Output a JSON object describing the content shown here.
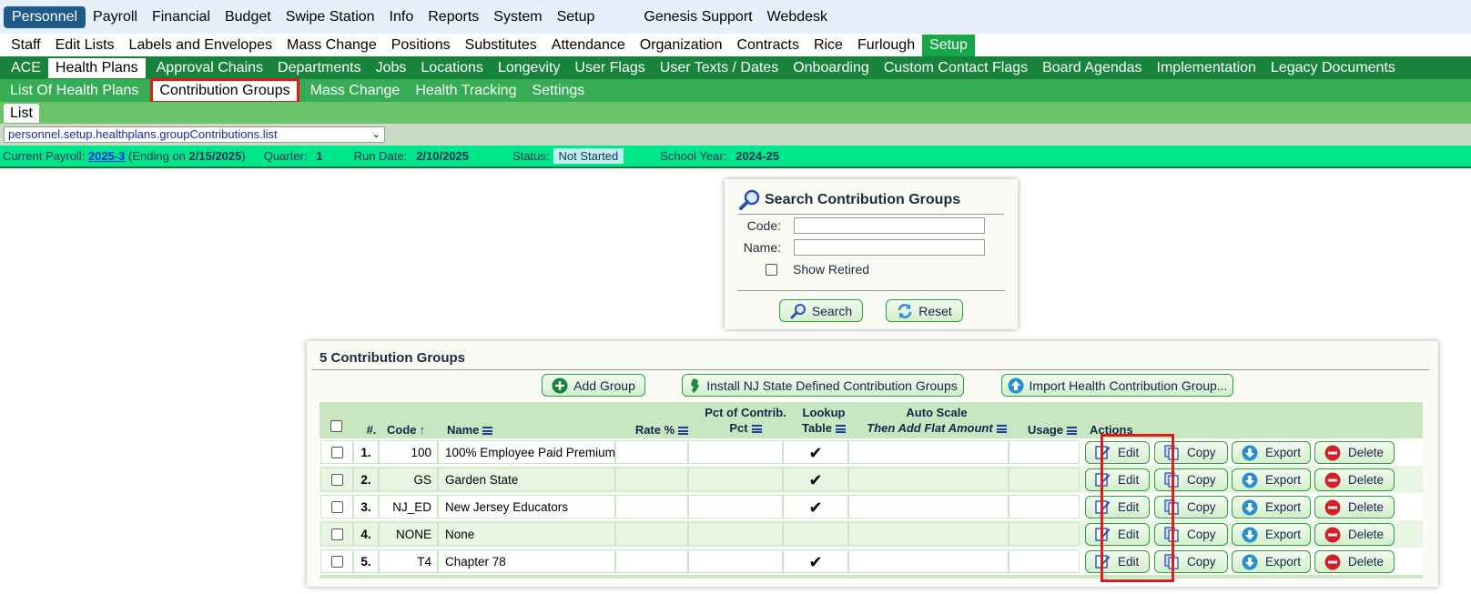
{
  "nav_top": [
    "Personnel",
    "Payroll",
    "Financial",
    "Budget",
    "Swipe Station",
    "Info",
    "Reports",
    "System",
    "Setup"
  ],
  "nav_top_right": [
    "Genesis Support",
    "Webdesk"
  ],
  "nav_second": [
    "Staff",
    "Edit Lists",
    "Labels and Envelopes",
    "Mass Change",
    "Positions",
    "Substitutes",
    "Attendance",
    "Organization",
    "Contracts",
    "Rice",
    "Furlough",
    "Setup"
  ],
  "nav_third": [
    "ACE",
    "Health Plans",
    "Approval Chains",
    "Departments",
    "Jobs",
    "Locations",
    "Longevity",
    "User Flags",
    "User Texts / Dates",
    "Onboarding",
    "Custom Contact Flags",
    "Board Agendas",
    "Implementation",
    "Legacy Documents"
  ],
  "nav_fourth": [
    "List Of Health Plans",
    "Contribution Groups",
    "Mass Change",
    "Health Tracking",
    "Settings"
  ],
  "nav_fifth": [
    "List"
  ],
  "path_select": "personnel.setup.healthplans.groupContributions.list",
  "status": {
    "payroll_label": "Current Payroll:",
    "payroll_link": "2025-3",
    "payroll_ending_open": " (Ending on ",
    "payroll_ending_date": "2/15/2025",
    "payroll_ending_close": ")",
    "quarter_label": "Quarter:",
    "quarter_value": "1",
    "run_date_label": "Run Date:",
    "run_date_value": "2/10/2025",
    "status_label": "Status:",
    "status_value": "Not Started",
    "school_year_label": "School Year:",
    "school_year_value": "2024-25"
  },
  "search": {
    "title": "Search Contribution Groups",
    "code_label": "Code:",
    "name_label": "Name:",
    "show_retired_label": "Show Retired",
    "search_button": "Search",
    "reset_button": "Reset"
  },
  "groups": {
    "title": "5 Contribution Groups",
    "add_group": "Add Group",
    "install_nj": "Install NJ State Defined Contribution Groups",
    "import": "Import Health Contribution Group...",
    "headers": {
      "num": "#.",
      "code": "Code",
      "name": "Name",
      "rate": "Rate %",
      "pct_line1": "Pct of Contrib.",
      "pct_line2": "Pct",
      "lookup_line1": "Lookup",
      "lookup_line2": "Table",
      "auto_line1": "Auto Scale",
      "auto_line2": "Then Add Flat Amount",
      "usage": "Usage",
      "actions": "Actions"
    },
    "rows": [
      {
        "num": "1.",
        "code": "100",
        "name": "100% Employee Paid Premium",
        "lookup": "✔"
      },
      {
        "num": "2.",
        "code": "GS",
        "name": "Garden State",
        "lookup": "✔"
      },
      {
        "num": "3.",
        "code": "NJ_ED",
        "name": "New Jersey Educators",
        "lookup": "✔"
      },
      {
        "num": "4.",
        "code": "NONE",
        "name": "None",
        "lookup": ""
      },
      {
        "num": "5.",
        "code": "T4",
        "name": "Chapter 78",
        "lookup": "✔"
      }
    ],
    "actions": {
      "edit": "Edit",
      "copy": "Copy",
      "export": "Export",
      "delete": "Delete"
    }
  },
  "colors": {
    "accent_green": "#17833b",
    "highlight_red": "#e11b1b",
    "personnel_blue": "#1f5b8a"
  }
}
